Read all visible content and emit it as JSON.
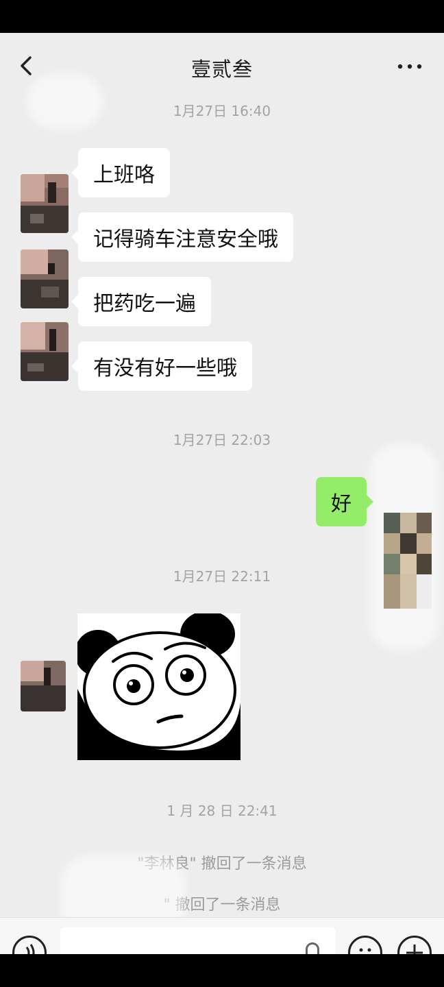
{
  "header": {
    "title": "壹贰叁",
    "back_icon": "chevron-left-icon",
    "more_icon": "ellipsis-icon"
  },
  "messages": {
    "ts1": "1月27日 16:40",
    "m1": "上班咯",
    "m2": "记得骑车注意安全哦",
    "m3": "把药吃一遍",
    "m4": "有没有好一些哦",
    "ts2": "1月27日 22:03",
    "reply": "好",
    "ts3": "1月27日 22:11",
    "ts4": "1 月 28 日 22:41",
    "recall1_name": "\"李林良\"",
    "recall1_text": " 撤回了一条消息",
    "recall2_name": "\"",
    "recall2_text": " 撤回了一条消息"
  },
  "input": {
    "voice_icon": "voice-icon",
    "emoji_icon": "emoji-icon",
    "plus_icon": "plus-icon",
    "mic_icon": "mic-icon"
  },
  "colors": {
    "background": "#ededed",
    "bubble_in": "#ffffff",
    "bubble_out": "#95ec69",
    "timestamp": "#a3a3a3"
  }
}
